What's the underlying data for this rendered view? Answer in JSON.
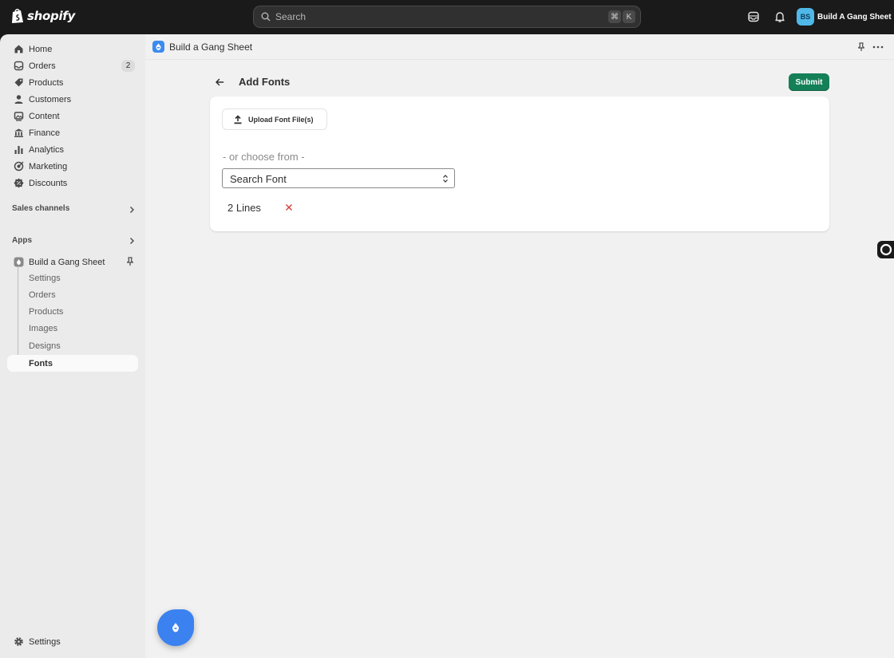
{
  "topbar": {
    "logo_text": "shopify",
    "search_placeholder": "Search",
    "shortcut_key1": "⌘",
    "shortcut_key2": "K",
    "store_initials": "BS",
    "store_name": "Build A Gang Sheet"
  },
  "sidebar": {
    "items": [
      {
        "label": "Home",
        "icon": "home-icon"
      },
      {
        "label": "Orders",
        "icon": "inbox-icon",
        "badge": "2"
      },
      {
        "label": "Products",
        "icon": "tag-icon"
      },
      {
        "label": "Customers",
        "icon": "person-icon"
      },
      {
        "label": "Content",
        "icon": "image-icon"
      },
      {
        "label": "Finance",
        "icon": "bank-icon"
      },
      {
        "label": "Analytics",
        "icon": "bar-chart-icon"
      },
      {
        "label": "Marketing",
        "icon": "target-icon"
      },
      {
        "label": "Discounts",
        "icon": "discount-icon"
      }
    ],
    "sales_channels_label": "Sales channels",
    "apps_label": "Apps",
    "app_name": "Build a Gang Sheet",
    "app_subitems": [
      "Settings",
      "Orders",
      "Products",
      "Images",
      "Designs",
      "Fonts"
    ],
    "settings_label": "Settings"
  },
  "main": {
    "app_title": "Build a Gang Sheet",
    "page_title": "Add Fonts",
    "submit_label": "Submit",
    "upload_label": "Upload Font File(s)",
    "or_choose_label": "- or choose from -",
    "select_value": "Search Font",
    "fonts": [
      "2 Lines"
    ]
  },
  "colors": {
    "accent_green": "#148058",
    "app_blue": "#3b82f0",
    "remove_red": "#d93a3a"
  }
}
